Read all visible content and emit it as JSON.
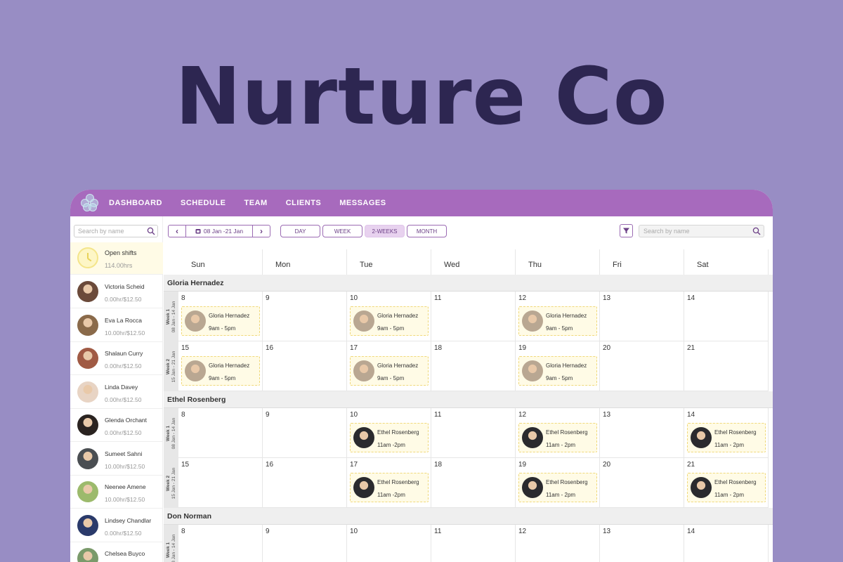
{
  "hero": {
    "title": "Nurture Co"
  },
  "nav": {
    "items": [
      "DASHBOARD",
      "SCHEDULE",
      "TEAM",
      "CLIENTS",
      "MESSAGES"
    ]
  },
  "sidebar": {
    "search_placeholder": "Search by name",
    "open_shifts": {
      "title": "Open shifts",
      "hours": "114.00hrs"
    },
    "staff": [
      {
        "name": "Victoria Scheid",
        "rate": "0.00hr/$12.50",
        "avatar_color": "#6b4a3a"
      },
      {
        "name": "Eva La Rocca",
        "rate": "10.00hr/$12.50",
        "avatar_color": "#8a6a4a"
      },
      {
        "name": "Shalaun Curry",
        "rate": "0.00hr/$12.50",
        "avatar_color": "#a05a44"
      },
      {
        "name": "Linda Davey",
        "rate": "0.00hr/$12.50",
        "avatar_color": "#e8d4c4"
      },
      {
        "name": "Glenda Orchant",
        "rate": "0.00hr/$12.50",
        "avatar_color": "#2a2320"
      },
      {
        "name": "Sumeet Sahni",
        "rate": "10.00hr/$12.50",
        "avatar_color": "#4a4e52"
      },
      {
        "name": "Neenee Amene",
        "rate": "10.00hr/$12.50",
        "avatar_color": "#9cba6c"
      },
      {
        "name": "Lindsey Chandlar",
        "rate": "0.00hr/$12.50",
        "avatar_color": "#2a3a6a"
      },
      {
        "name": "Chelsea Buyco",
        "rate": "0.00hr/$12.50",
        "avatar_color": "#7a9a6a"
      }
    ]
  },
  "toolbar": {
    "prev_icon": "chevron-left-icon",
    "next_icon": "chevron-right-icon",
    "date_range": "08 Jan -21 Jan",
    "views": [
      "DAY",
      "WEEK",
      "2-WEEKS",
      "MONTH"
    ],
    "active_view": "2-WEEKS",
    "search_placeholder": "Search by name"
  },
  "calendar": {
    "days": [
      "Sun",
      "Mon",
      "Tue",
      "Wed",
      "Thu",
      "Fri",
      "Sat"
    ],
    "week_labels": [
      {
        "title": "Week 1",
        "range": "08 Jan - 14 Jan"
      },
      {
        "title": "Week 2",
        "range": "15 Jan - 21 Jan"
      }
    ],
    "groups": [
      {
        "name": "Gloria Hernadez",
        "weeks": [
          {
            "dates": [
              "8",
              "9",
              "10",
              "11",
              "12",
              "13",
              "14"
            ],
            "shifts": [
              {
                "day": 0,
                "name": "Gloria Hernadez",
                "time": "9am - 5pm"
              },
              {
                "day": 2,
                "name": "Gloria Hernadez",
                "time": "9am - 5pm"
              },
              {
                "day": 4,
                "name": "Gloria Hernadez",
                "time": "9am - 5pm"
              }
            ]
          },
          {
            "dates": [
              "15",
              "16",
              "17",
              "18",
              "19",
              "20",
              "21"
            ],
            "shifts": [
              {
                "day": 0,
                "name": "Gloria Hernadez",
                "time": "9am - 5pm"
              },
              {
                "day": 2,
                "name": "Gloria Hernadez",
                "time": "9am - 5pm"
              },
              {
                "day": 4,
                "name": "Gloria Hernadez",
                "time": "9am - 5pm"
              }
            ]
          }
        ]
      },
      {
        "name": "Ethel Rosenberg",
        "weeks": [
          {
            "dates": [
              "8",
              "9",
              "10",
              "11",
              "12",
              "13",
              "14"
            ],
            "shifts": [
              {
                "day": 2,
                "name": "Ethel Rosenberg",
                "time": "11am -2pm"
              },
              {
                "day": 4,
                "name": "Ethel Rosenberg",
                "time": "11am - 2pm"
              },
              {
                "day": 6,
                "name": "Ethel Rosenberg",
                "time": "11am - 2pm"
              }
            ]
          },
          {
            "dates": [
              "15",
              "16",
              "17",
              "18",
              "19",
              "20",
              "21"
            ],
            "shifts": [
              {
                "day": 2,
                "name": "Ethel Rosenberg",
                "time": "11am -2pm"
              },
              {
                "day": 4,
                "name": "Ethel Rosenberg",
                "time": "11am - 2pm"
              },
              {
                "day": 6,
                "name": "Ethel Rosenberg",
                "time": "11am - 2pm"
              }
            ]
          }
        ]
      },
      {
        "name": "Don Norman",
        "weeks": [
          {
            "dates": [
              "8",
              "9",
              "10",
              "11",
              "12",
              "13",
              "14"
            ],
            "shifts": []
          }
        ]
      }
    ]
  },
  "colors": {
    "brand": "#a76abd",
    "accent": "#6b3f86",
    "shift_bg": "#fffbe6",
    "gloria_avatar": "#b9a792",
    "ethel_avatar": "#2a2a2e"
  }
}
